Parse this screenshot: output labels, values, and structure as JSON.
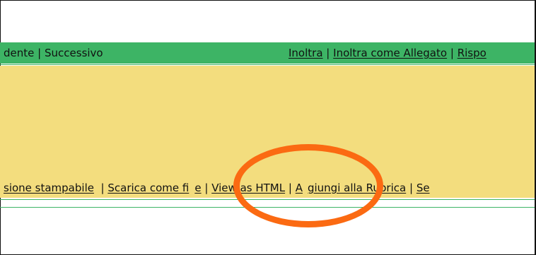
{
  "nav": {
    "left": {
      "prev_fragment": "dente",
      "sep": "|",
      "next": "Successivo"
    },
    "right": {
      "forward": "Inoltra",
      "sep1": "|",
      "forward_attachment": "Inoltra come Allegato",
      "sep2": "|",
      "reply_fragment": "Rispo"
    }
  },
  "tools": {
    "printable_fragment": "sione stampabile",
    "sep1": "|",
    "download_fragment_left": "Scarica come fi",
    "download_fragment_right": "e",
    "sep2": "|",
    "view_html": "View as HTML",
    "sep3": "|",
    "add_addressbook_fragment_left": "A",
    "add_addressbook_fragment_right": "giungi alla Rubrica",
    "sep4": "|",
    "next_fragment": "Se"
  },
  "colors": {
    "nav_bar": "#3db465",
    "content_bg": "#f3dd7e",
    "highlight": "#fb6a12"
  }
}
